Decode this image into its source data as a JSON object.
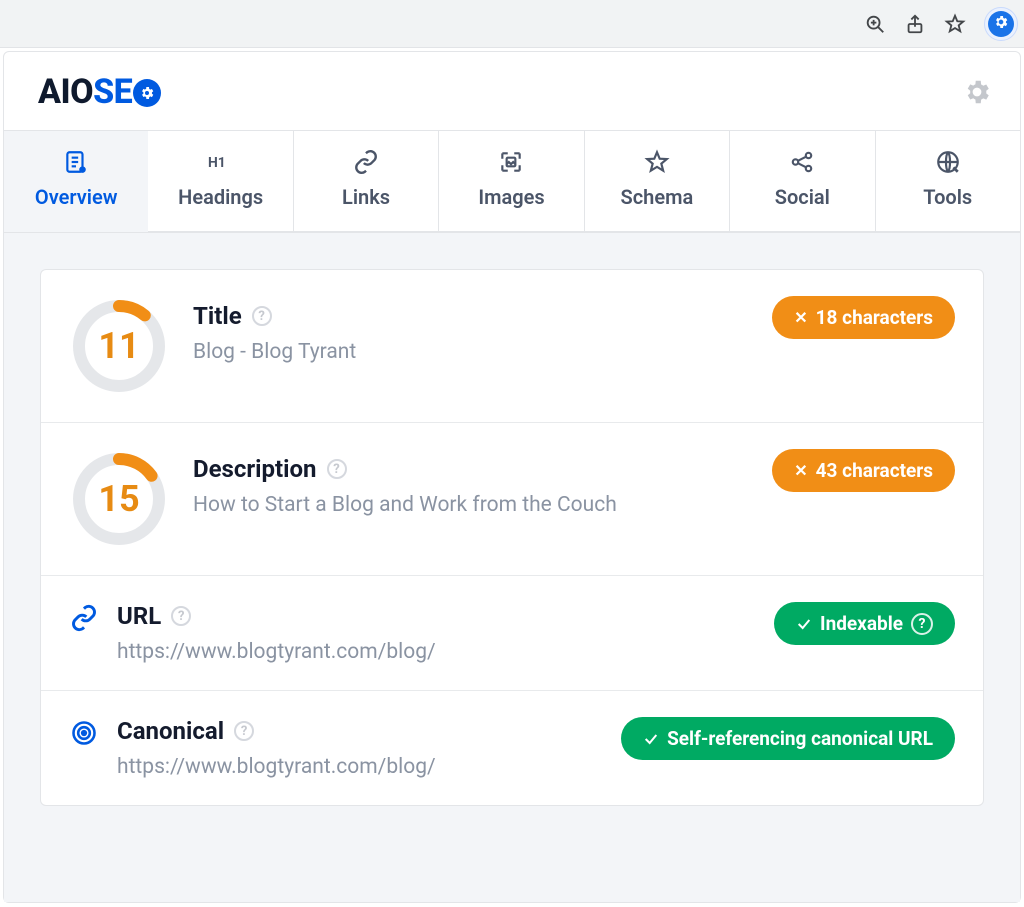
{
  "logo": {
    "aio": "AIO",
    "se": "SE"
  },
  "tabs": [
    {
      "key": "overview",
      "label": "Overview"
    },
    {
      "key": "headings",
      "label": "Headings"
    },
    {
      "key": "links",
      "label": "Links"
    },
    {
      "key": "images",
      "label": "Images"
    },
    {
      "key": "schema",
      "label": "Schema"
    },
    {
      "key": "social",
      "label": "Social"
    },
    {
      "key": "tools",
      "label": "Tools"
    }
  ],
  "sections": {
    "title": {
      "label": "Title",
      "score": "11",
      "value": "Blog - Blog Tyrant",
      "badge": "18 characters"
    },
    "description": {
      "label": "Description",
      "score": "15",
      "value": "How to Start a Blog and Work from the Couch",
      "badge": "43 characters"
    },
    "url": {
      "label": "URL",
      "value": "https://www.blogtyrant.com/blog/",
      "badge": "Indexable"
    },
    "canonical": {
      "label": "Canonical",
      "value": "https://www.blogtyrant.com/blog/",
      "badge": "Self-referencing canonical URL"
    }
  },
  "colors": {
    "accent": "#005ae0",
    "warn": "#f18e16",
    "ok": "#00aa63"
  }
}
